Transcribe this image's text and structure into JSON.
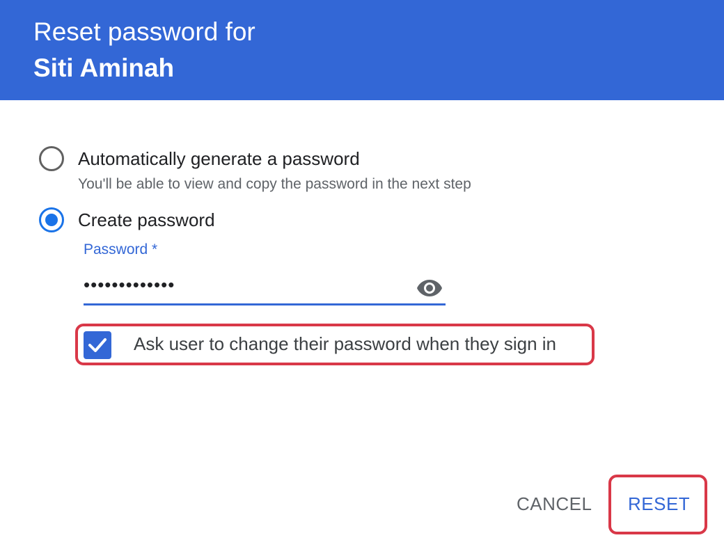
{
  "header": {
    "title_line1": "Reset password for",
    "title_line2": "Siti Aminah",
    "background": "#3367d6"
  },
  "options": {
    "auto": {
      "label": "Automatically generate a password",
      "sublabel": "You'll be able to view and copy the password in the next step",
      "selected": false
    },
    "create": {
      "label": "Create password",
      "selected": true
    }
  },
  "password_field": {
    "label": "Password *",
    "value": "•••••••••••••",
    "toggle_icon": "eye-icon"
  },
  "change_on_signin": {
    "label": "Ask user to change their password when they sign in",
    "checked": true
  },
  "actions": {
    "cancel_label": "CANCEL",
    "reset_label": "RESET"
  },
  "colors": {
    "accent": "#3367d6",
    "radio_selected": "#1a73e8",
    "highlight": "#d93848"
  }
}
